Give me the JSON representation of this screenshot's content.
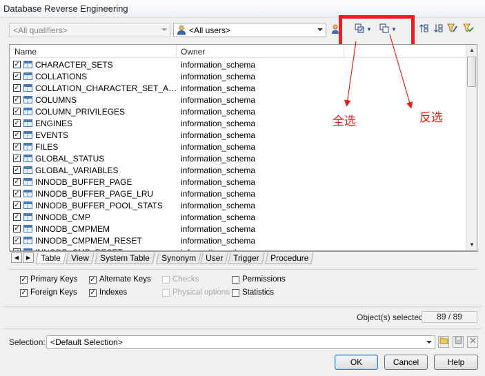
{
  "window": {
    "title": "Database Reverse Engineering"
  },
  "toolbar": {
    "qualifiers_value": "<All qualifiers>",
    "users_value": "<All users>",
    "select_all_icon": "select-all-icon",
    "invert_select_icon": "invert-selection-icon"
  },
  "list": {
    "col_name": "Name",
    "col_owner": "Owner",
    "rows": [
      {
        "name": "CHARACTER_SETS",
        "owner": "information_schema"
      },
      {
        "name": "COLLATIONS",
        "owner": "information_schema"
      },
      {
        "name": "COLLATION_CHARACTER_SET_APPLICABILITY",
        "owner": "information_schema"
      },
      {
        "name": "COLUMNS",
        "owner": "information_schema"
      },
      {
        "name": "COLUMN_PRIVILEGES",
        "owner": "information_schema"
      },
      {
        "name": "ENGINES",
        "owner": "information_schema"
      },
      {
        "name": "EVENTS",
        "owner": "information_schema"
      },
      {
        "name": "FILES",
        "owner": "information_schema"
      },
      {
        "name": "GLOBAL_STATUS",
        "owner": "information_schema"
      },
      {
        "name": "GLOBAL_VARIABLES",
        "owner": "information_schema"
      },
      {
        "name": "INNODB_BUFFER_PAGE",
        "owner": "information_schema"
      },
      {
        "name": "INNODB_BUFFER_PAGE_LRU",
        "owner": "information_schema"
      },
      {
        "name": "INNODB_BUFFER_POOL_STATS",
        "owner": "information_schema"
      },
      {
        "name": "INNODB_CMP",
        "owner": "information_schema"
      },
      {
        "name": "INNODB_CMPMEM",
        "owner": "information_schema"
      },
      {
        "name": "INNODB_CMPMEM_RESET",
        "owner": "information_schema"
      },
      {
        "name": "INNODB_CMP_RESET",
        "owner": "information_schema"
      }
    ]
  },
  "tabs": [
    "Table",
    "View",
    "System Table",
    "Synonym",
    "User",
    "Trigger",
    "Procedure"
  ],
  "options": {
    "primary_keys": "Primary Keys",
    "alternate_keys": "Alternate Keys",
    "checks": "Checks",
    "permissions": "Permissions",
    "foreign_keys": "Foreign Keys",
    "indexes": "Indexes",
    "physical_options": "Physical options",
    "statistics": "Statistics"
  },
  "status": {
    "label": "Object(s) selected:",
    "value": "89 / 89"
  },
  "selection": {
    "label": "Selection:",
    "value": "<Default Selection>"
  },
  "buttons": {
    "ok": "OK",
    "cancel": "Cancel",
    "help": "Help"
  },
  "annotations": {
    "select_all": "全选",
    "invert": "反选",
    "color": "#e0211c"
  }
}
